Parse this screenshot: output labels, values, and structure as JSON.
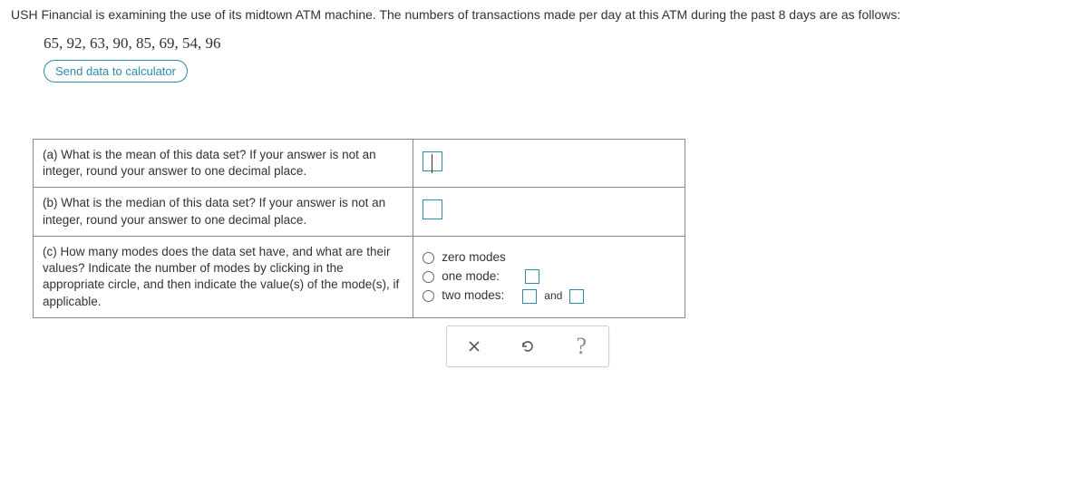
{
  "stem": "USH Financial is examining the use of its midtown ATM machine. The numbers of transactions made per day at this ATM during the past 8 days are as follows:",
  "data_list": "65, 92, 63, 90, 85, 69, 54, 96",
  "send_label": "Send data to calculator",
  "parts": {
    "a": "(a) What is the mean of this data set? If your answer is not an integer, round your answer to one decimal place.",
    "b": "(b) What is the median of this data set? If your answer is not an integer, round your answer to one decimal place.",
    "c": "(c) How many modes does the data set have, and what are their values? Indicate the number of modes by clicking in the appropriate circle, and then indicate the value(s) of the mode(s), if applicable."
  },
  "mode_options": {
    "zero": "zero modes",
    "one": "one mode:",
    "two": "two modes:",
    "and": "and"
  },
  "toolbar": {
    "clear": "×",
    "help": "?"
  }
}
